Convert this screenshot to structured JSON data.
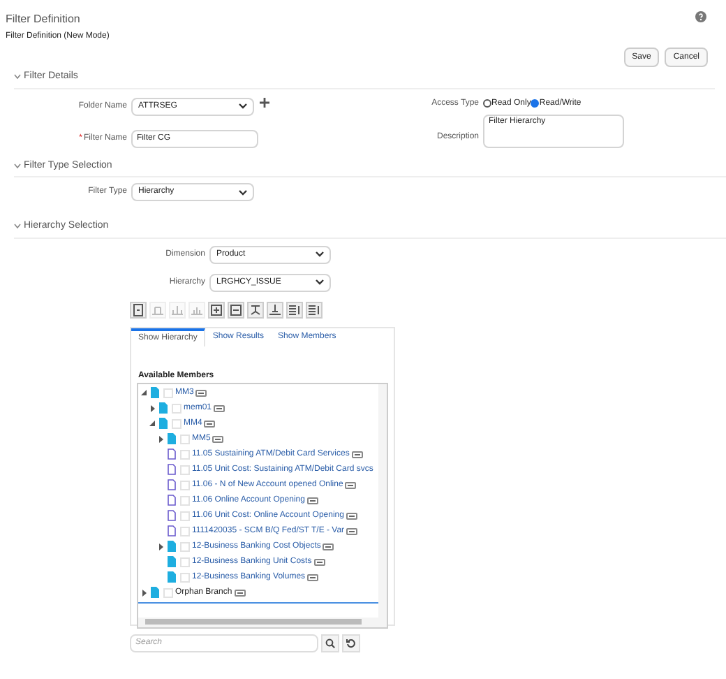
{
  "header": {
    "title": "Filter Definition",
    "subtitle": "Filter Definition (New Mode)"
  },
  "actions": [
    "Save",
    "Cancel"
  ],
  "filter_details": {
    "heading": "Filter Details",
    "folder_label": "Folder Name",
    "folder_value": "ATTRSEG",
    "access_label": "Access Type",
    "access_options": [
      {
        "label": "Read Only",
        "selected": false
      },
      {
        "label": "Read/Write",
        "selected": true
      }
    ],
    "name_label": "Filter Name",
    "name_required_mark": "*",
    "name_value": "Filter CG",
    "description_label": "Description",
    "description_value": "Filter Hierarchy"
  },
  "filter_type_selection": {
    "heading": "Filter Type Selection",
    "type_label": "Filter Type",
    "type_value": "Hierarchy"
  },
  "hierarchy_selection": {
    "heading": "Hierarchy Selection",
    "dimension_label": "Dimension",
    "dimension_value": "Product",
    "hierarchy_label": "Hierarchy",
    "hierarchy_value": "LRGHCY_ISSUE"
  },
  "toolbar": [
    {
      "disabled": false
    },
    {
      "disabled": true
    },
    {
      "disabled": true
    },
    {
      "disabled": true
    },
    {
      "disabled": false
    },
    {
      "disabled": false
    },
    {
      "disabled": false
    },
    {
      "disabled": false
    },
    {
      "disabled": false
    },
    {
      "disabled": false
    }
  ],
  "tabs": [
    {
      "label": "Show Hierarchy",
      "selected": true
    },
    {
      "label": "Show Results",
      "selected": false
    },
    {
      "label": "Show Members",
      "selected": false
    }
  ],
  "tree": {
    "heading": "Available Members",
    "items": [
      {
        "label": "MM3",
        "kind": "folder",
        "checked": false,
        "expanded": true,
        "menu": true,
        "children": [
          {
            "label": "mem01",
            "kind": "folder",
            "checked": false,
            "expanded": false,
            "menu": true
          },
          {
            "label": "MM4",
            "kind": "folder",
            "checked": false,
            "expanded": true,
            "menu": true,
            "children": [
              {
                "label": "MM5",
                "kind": "folder",
                "checked": false,
                "expanded": false,
                "menu": true
              },
              {
                "label": "11.05 Sustaining ATM/Debit Card Services",
                "kind": "leaf",
                "checked": false,
                "menu": true
              },
              {
                "label": "11.05 Unit Cost: Sustaining ATM/Debit Card svcs",
                "kind": "leaf",
                "checked": false,
                "menu": false
              },
              {
                "label": "11.06 - N of New Account opened Online",
                "kind": "leaf",
                "checked": false,
                "menu": true
              },
              {
                "label": "11.06 Online Account Opening",
                "kind": "leaf",
                "checked": false,
                "menu": true
              },
              {
                "label": "11.06 Unit Cost: Online Account Opening",
                "kind": "leaf",
                "checked": false,
                "menu": true
              },
              {
                "label": "1111420035 - SCM B/Q Fed/ST T/E - Var",
                "kind": "leaf",
                "checked": false,
                "menu": true
              },
              {
                "label": "12-Business Banking Cost Objects",
                "kind": "folder",
                "checked": false,
                "expanded": false,
                "menu": true
              },
              {
                "label": "12-Business Banking Unit Costs",
                "kind": "folder",
                "checked": false,
                "menu": true
              },
              {
                "label": "12-Business Banking Volumes",
                "kind": "folder",
                "checked": false,
                "menu": true
              }
            ]
          }
        ]
      },
      {
        "label": "Orphan Branch",
        "kind": "branch",
        "checked": false,
        "expanded": false,
        "menu": true
      }
    ]
  },
  "search": {
    "placeholder": "Search"
  }
}
